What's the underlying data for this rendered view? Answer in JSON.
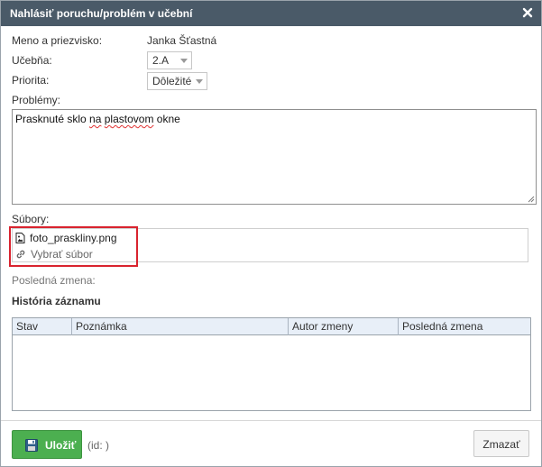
{
  "dialog": {
    "title": "Nahlásiť poruchu/problém v učební"
  },
  "form": {
    "name_label": "Meno a priezvisko:",
    "name_value": "Janka Šťastná",
    "room_label": "Učebňa:",
    "room_value": "2.A",
    "priority_label": "Priorita:",
    "priority_value": "Dôležité",
    "problems_label": "Problémy:",
    "problems_text_prefix": "Prasknuté sklo ",
    "problems_text_spell1": "na",
    "problems_text_mid": " ",
    "problems_text_spell2": "plastovom",
    "problems_text_suffix": " okne"
  },
  "files": {
    "label": "Súbory:",
    "file_name": "foto_praskliny.png",
    "pick_label": "Vybrať súbor"
  },
  "last_change": {
    "label": "Posledná zmena:"
  },
  "history": {
    "title": "História záznamu",
    "columns": [
      "Stav",
      "Poznámka",
      "Autor zmeny",
      "Posledná zmena"
    ]
  },
  "footer": {
    "save_label": "Uložiť",
    "id_text": "(id: )",
    "delete_label": "Zmazať"
  },
  "icons": {
    "close": "close-icon",
    "image_file": "image-file-icon",
    "link": "link-icon",
    "save": "save-disk-icon"
  },
  "colors": {
    "titlebar": "#4a5a68",
    "save_button": "#4caf50",
    "highlight": "#d9232e",
    "grid_header": "#e8eff8"
  }
}
